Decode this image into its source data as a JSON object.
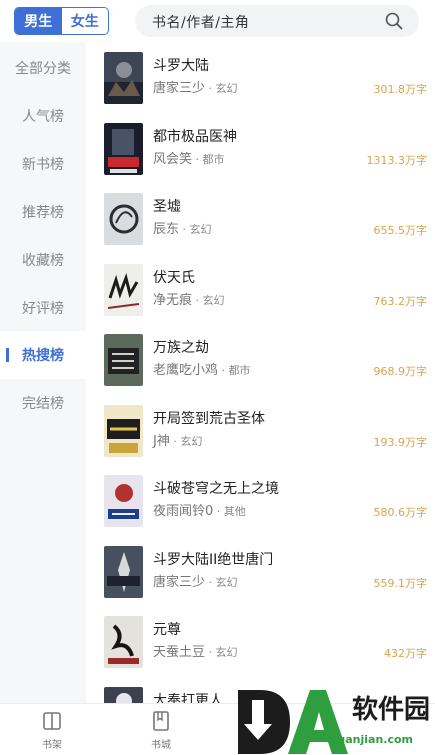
{
  "header": {
    "tabs": [
      {
        "label": "男生",
        "active": true
      },
      {
        "label": "女生",
        "active": false
      }
    ],
    "search": {
      "placeholder": "书名/作者/主角",
      "icon": "search-icon"
    }
  },
  "sidebar": {
    "items": [
      {
        "label": "全部分类",
        "active": false
      },
      {
        "label": "人气榜",
        "active": false
      },
      {
        "label": "新书榜",
        "active": false
      },
      {
        "label": "推荐榜",
        "active": false
      },
      {
        "label": "收藏榜",
        "active": false
      },
      {
        "label": "好评榜",
        "active": false
      },
      {
        "label": "热搜榜",
        "active": true
      },
      {
        "label": "完结榜",
        "active": false
      }
    ]
  },
  "books": [
    {
      "title": "斗罗大陆",
      "author": "唐家三少",
      "genre": "玄幻",
      "words": "301.8万字"
    },
    {
      "title": "都市极品医神",
      "author": "风会笑",
      "genre": "都市",
      "words": "1313.3万字"
    },
    {
      "title": "圣墟",
      "author": "辰东",
      "genre": "玄幻",
      "words": "655.5万字"
    },
    {
      "title": "伏天氏",
      "author": "净无痕",
      "genre": "玄幻",
      "words": "763.2万字"
    },
    {
      "title": "万族之劫",
      "author": "老鹰吃小鸡",
      "genre": "都市",
      "words": "968.9万字"
    },
    {
      "title": "开局签到荒古圣体",
      "author": "J神",
      "genre": "玄幻",
      "words": "193.9万字"
    },
    {
      "title": "斗破苍穹之无上之境",
      "author": "夜雨闻铃0",
      "genre": "其他",
      "words": "580.6万字"
    },
    {
      "title": "斗罗大陆II绝世唐门",
      "author": "唐家三少",
      "genre": "玄幻",
      "words": "559.1万字"
    },
    {
      "title": "元尊",
      "author": "天蚕土豆",
      "genre": "玄幻",
      "words": "432万字"
    },
    {
      "title": "大奉打更人",
      "author": "",
      "genre": "",
      "words": ""
    }
  ],
  "bottom_nav": [
    {
      "label": "书架",
      "icon": "bookshelf-icon"
    },
    {
      "label": "书城",
      "icon": "bookstore-icon"
    }
  ],
  "watermark": {
    "text": "软件园",
    "url": "ruanjian.com",
    "logo": "DA"
  },
  "colors": {
    "accent": "#3d6fd6",
    "word_count": "#d7a34e",
    "sidebar_bg": "#f6f7f8"
  }
}
